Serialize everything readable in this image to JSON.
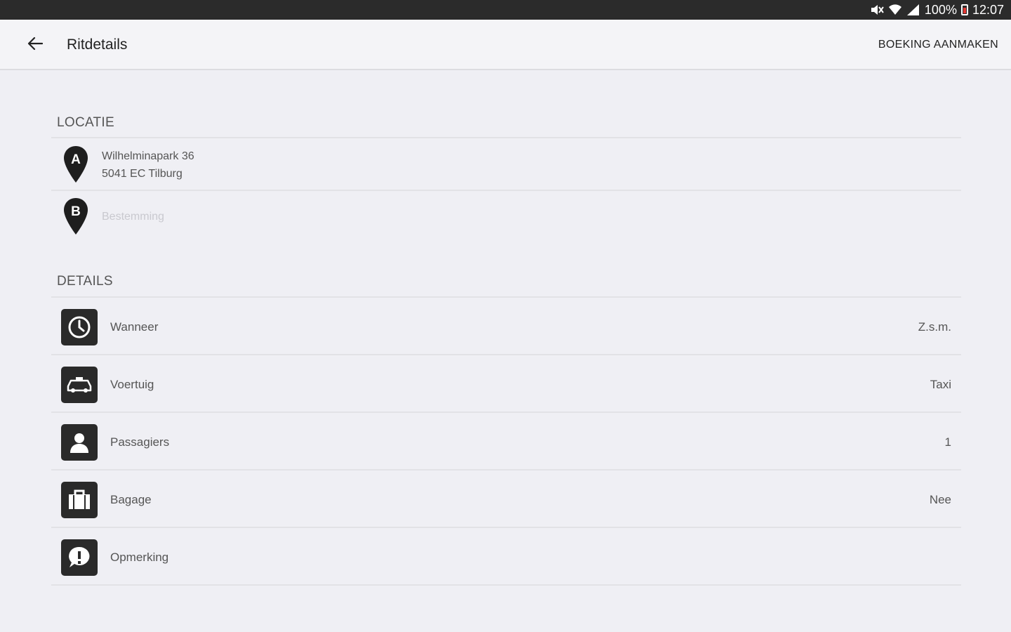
{
  "status_bar": {
    "battery_text": "100%",
    "time": "12:07",
    "icons": [
      "mute-icon",
      "wifi-icon",
      "signal-icon",
      "battery-icon"
    ]
  },
  "app_bar": {
    "title": "Ritdetails",
    "action": "BOEKING AANMAKEN",
    "back_icon": "arrow-back-icon"
  },
  "location": {
    "section_title": "LOCATIE",
    "pickup": {
      "marker": "A",
      "line1": "Wilhelminapark 36",
      "line2": "5041 EC Tilburg"
    },
    "destination": {
      "marker": "B",
      "placeholder": "Bestemming"
    }
  },
  "details": {
    "section_title": "DETAILS",
    "rows": [
      {
        "icon": "clock-icon",
        "label": "Wanneer",
        "value": "Z.s.m."
      },
      {
        "icon": "car-icon",
        "label": "Voertuig",
        "value": "Taxi"
      },
      {
        "icon": "person-icon",
        "label": "Passagiers",
        "value": "1"
      },
      {
        "icon": "luggage-icon",
        "label": "Bagage",
        "value": "Nee"
      },
      {
        "icon": "comment-icon",
        "label": "Opmerking",
        "value": ""
      }
    ]
  },
  "colors": {
    "background": "#efeff4",
    "status_bar": "#2b2b2b",
    "icon_tile": "#2a2a2a",
    "placeholder": "#c9c9cf"
  }
}
